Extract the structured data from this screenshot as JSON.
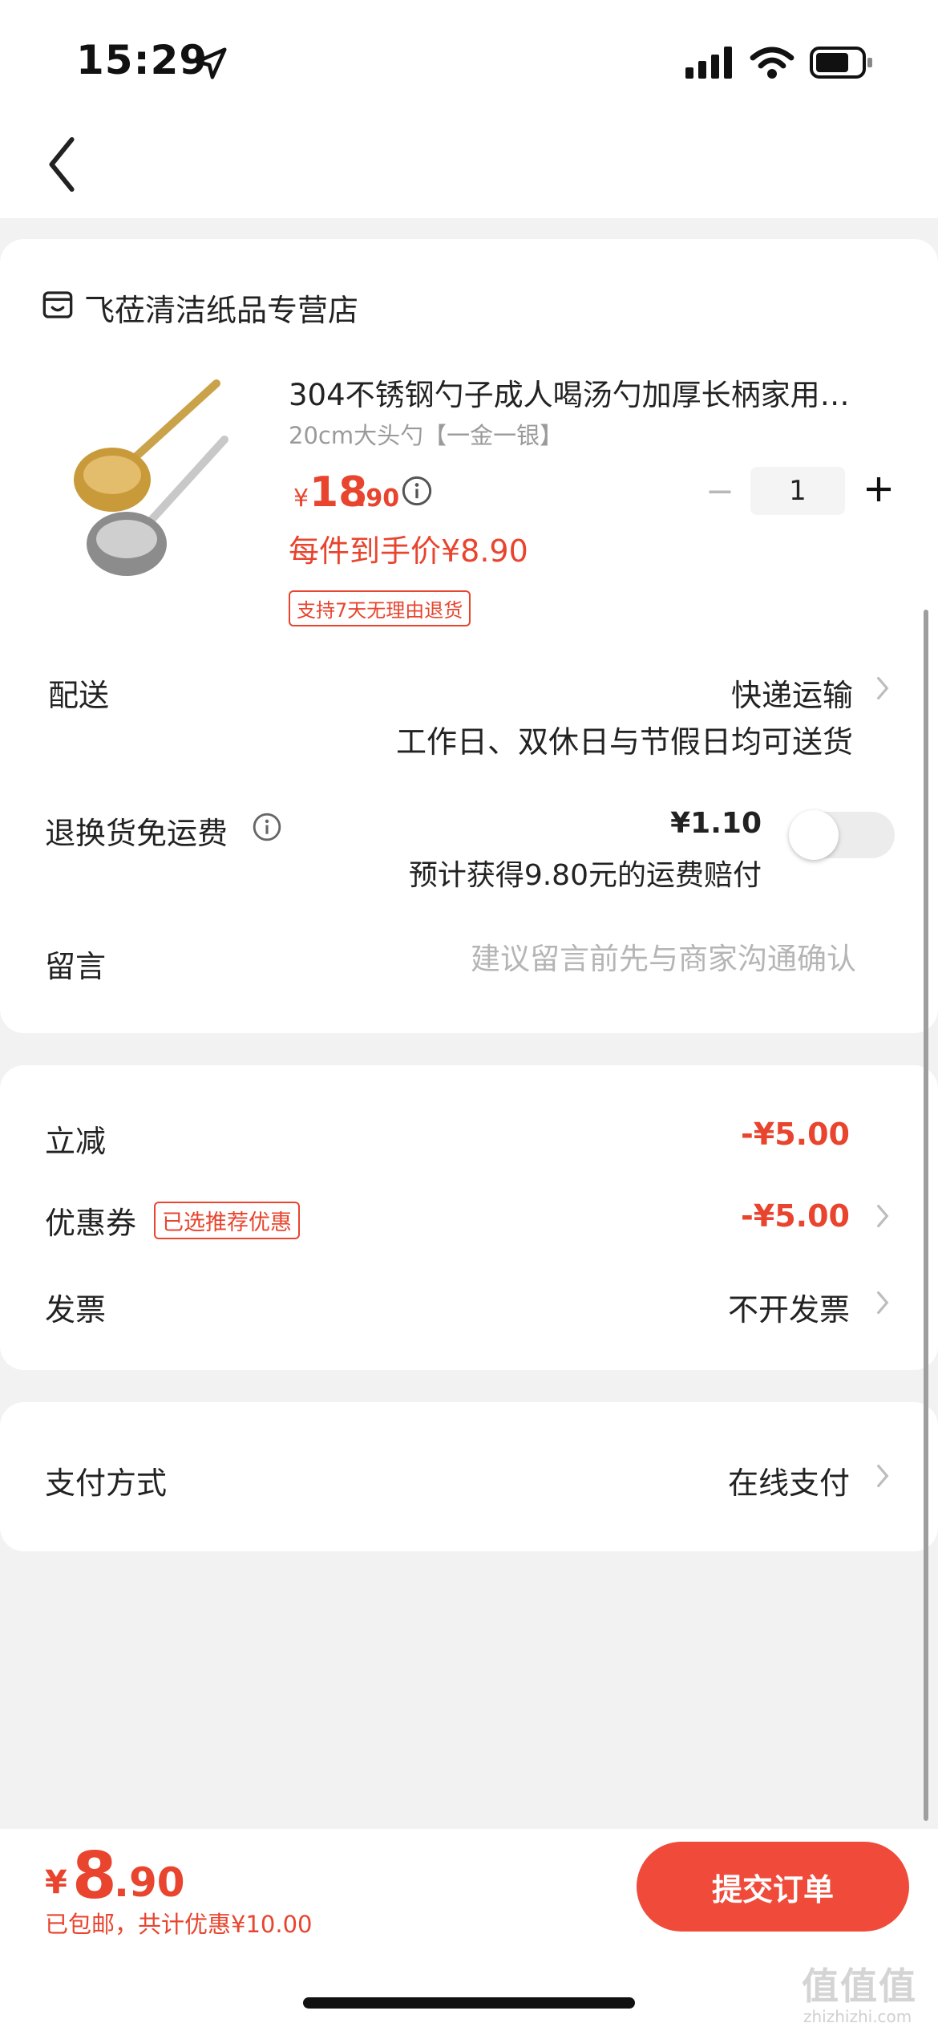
{
  "status_bar": {
    "time": "15:29"
  },
  "shop": {
    "name": "飞莅清洁纸品专营店"
  },
  "product": {
    "title": "304不锈钢勺子成人喝汤勺加厚长柄家用…",
    "spec": "20cm大头勺【一金一银】",
    "price_currency": "¥",
    "price_int": "18",
    "price_dec": ".90",
    "unit_price": "每件到手价¥8.90",
    "return_tag": "支持7天无理由退货",
    "quantity": "1"
  },
  "delivery": {
    "label": "配送",
    "method": "快递运输",
    "note": "工作日、双休日与节假日均可送货"
  },
  "return_insurance": {
    "label": "退换货免运费",
    "price": "¥1.10",
    "note": "预计获得9.80元的运费赔付",
    "enabled": false
  },
  "message": {
    "label": "留言",
    "placeholder": "建议留言前先与商家沟通确认"
  },
  "discounts": {
    "instant_label": "立减",
    "instant_value": "-¥5.00",
    "coupon_label": "优惠券",
    "coupon_tag": "已选推荐优惠",
    "coupon_value": "-¥5.00",
    "invoice_label": "发票",
    "invoice_value": "不开发票"
  },
  "payment": {
    "label": "支付方式",
    "value": "在线支付"
  },
  "footer": {
    "total_currency": "¥",
    "total_int": "8",
    "total_dec": ".90",
    "summary": "已包邮，共计优惠¥10.00",
    "submit_label": "提交订单"
  },
  "watermark": {
    "main": "值值值",
    "sub": "zhizhizhi.com"
  },
  "colors": {
    "accent": "#e8442e",
    "button": "#ef4a3a",
    "background": "#f2f2f2"
  }
}
